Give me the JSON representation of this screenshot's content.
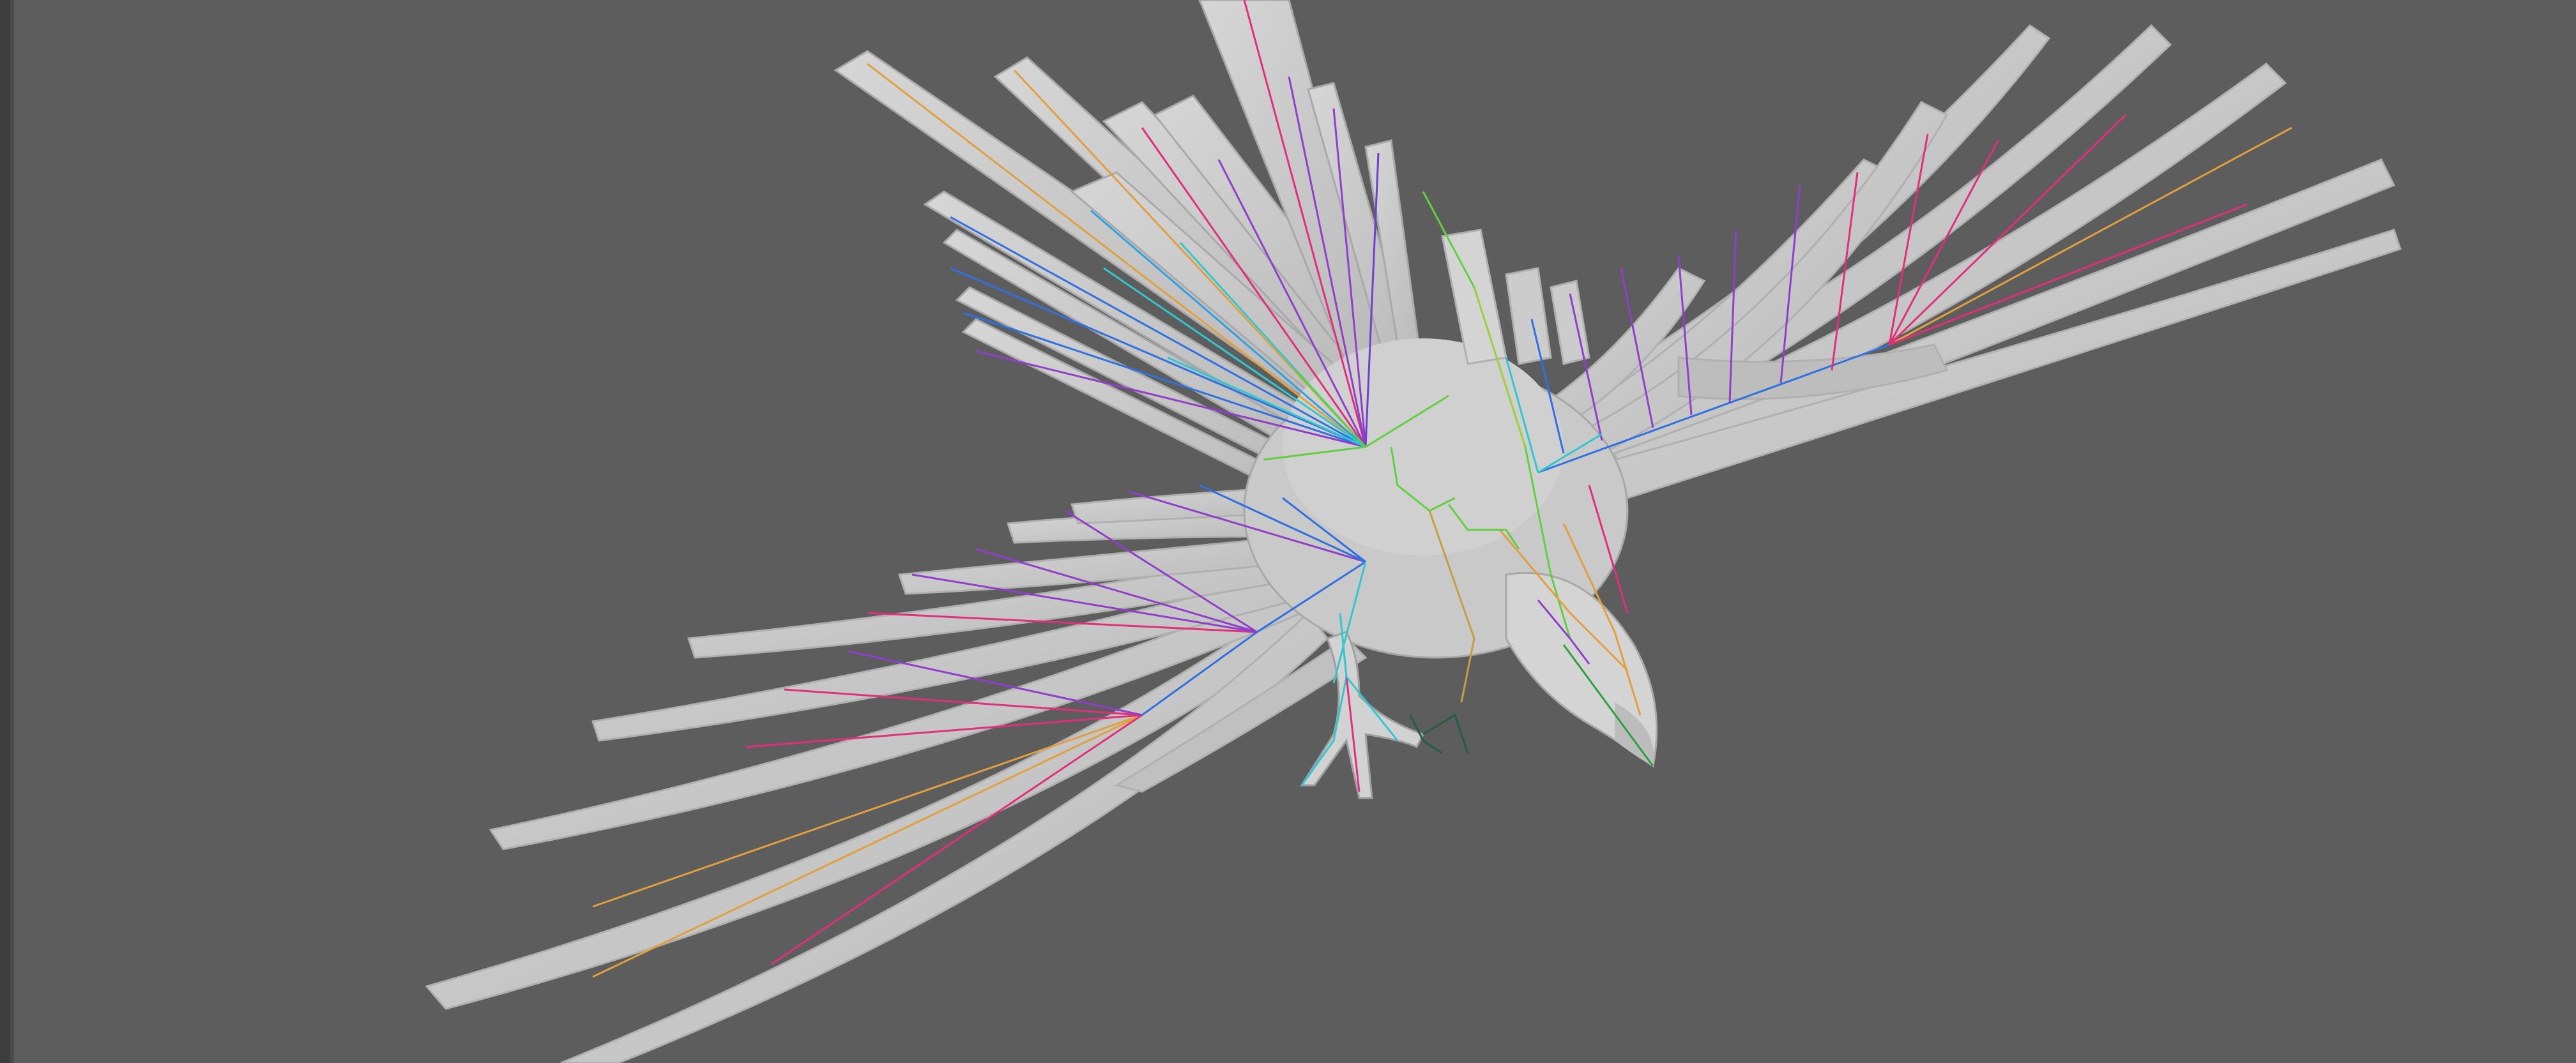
{
  "viewport": {
    "background_color": "#5d5d5d",
    "model": "bird-rig",
    "mesh_color": "#cfcfcf",
    "bone_palette": [
      "#f0a030",
      "#e0307a",
      "#9040c8",
      "#3070e0",
      "#30c8d0",
      "#60d040"
    ]
  }
}
